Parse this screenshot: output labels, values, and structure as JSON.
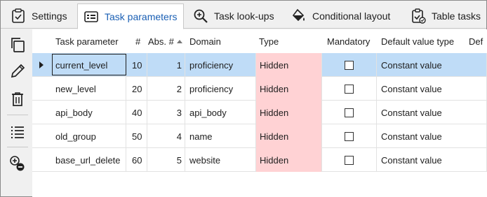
{
  "tabs": [
    {
      "label": "Settings",
      "icon": "checklist-icon",
      "active": false
    },
    {
      "label": "Task parameters",
      "icon": "parameters-icon",
      "active": true
    },
    {
      "label": "Task look-ups",
      "icon": "zoom-in-icon",
      "active": false
    },
    {
      "label": "Conditional layout",
      "icon": "paint-bucket-icon",
      "active": false
    },
    {
      "label": "Table tasks",
      "icon": "table-tasks-icon",
      "active": false
    }
  ],
  "toolbar": {
    "copy": "copy-icon",
    "edit": "pencil-icon",
    "delete": "trash-icon",
    "list": "list-icon",
    "add_remove": "add-remove-icon"
  },
  "grid": {
    "columns": [
      "Task parameter",
      "#",
      "Abs. #",
      "Domain",
      "Type",
      "Mandatory",
      "Default value type",
      "Def"
    ],
    "rows": [
      {
        "name": "current_level",
        "num": "10",
        "abs": "1",
        "domain": "proficiency",
        "type": "Hidden",
        "mandatory": false,
        "default_type": "Constant value"
      },
      {
        "name": "new_level",
        "num": "20",
        "abs": "2",
        "domain": "proficiency",
        "type": "Hidden",
        "mandatory": false,
        "default_type": "Constant value"
      },
      {
        "name": "api_body",
        "num": "40",
        "abs": "3",
        "domain": "api_body",
        "type": "Hidden",
        "mandatory": false,
        "default_type": "Constant value"
      },
      {
        "name": "old_group",
        "num": "50",
        "abs": "4",
        "domain": "name",
        "type": "Hidden",
        "mandatory": false,
        "default_type": "Constant value"
      },
      {
        "name": "base_url_delete",
        "num": "60",
        "abs": "5",
        "domain": "website",
        "type": "Hidden",
        "mandatory": false,
        "default_type": "Constant value"
      }
    ]
  },
  "colors": {
    "selected_row": "#bfdcf7",
    "hidden_type": "#ffd2d4",
    "active_tab_text": "#1a5fb4"
  }
}
